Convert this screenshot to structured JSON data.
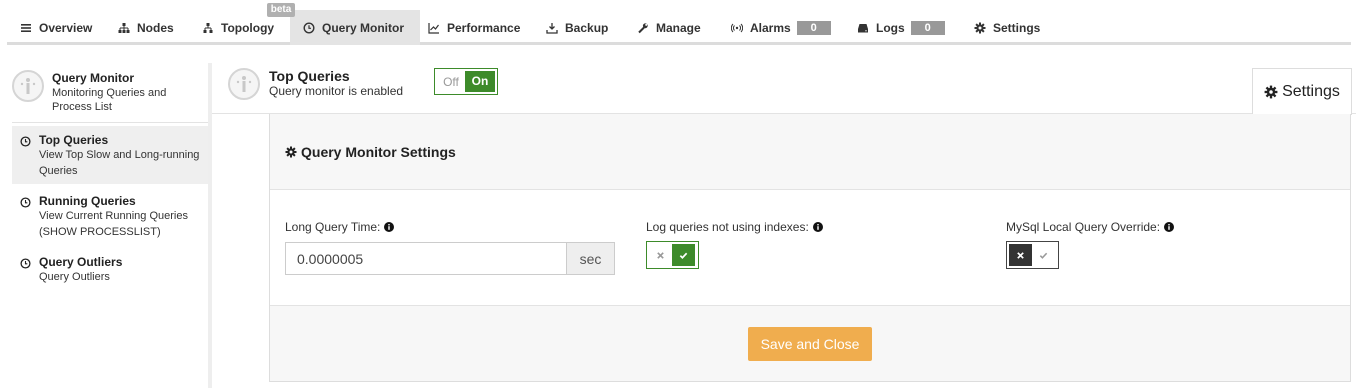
{
  "nav": {
    "beta_badge": "beta",
    "items": [
      {
        "label": "Overview",
        "icon": "list-icon"
      },
      {
        "label": "Nodes",
        "icon": "sitemap-icon"
      },
      {
        "label": "Topology",
        "icon": "topology-icon"
      },
      {
        "label": "Query Monitor",
        "icon": "clock-icon",
        "active": true
      },
      {
        "label": "Performance",
        "icon": "line-chart-icon"
      },
      {
        "label": "Backup",
        "icon": "download-icon"
      },
      {
        "label": "Manage",
        "icon": "wrench-icon"
      },
      {
        "label": "Alarms",
        "icon": "broadcast-icon",
        "badge": "0"
      },
      {
        "label": "Logs",
        "icon": "hdd-icon",
        "badge": "0"
      },
      {
        "label": "Settings",
        "icon": "gear-icon"
      }
    ]
  },
  "sidebar": {
    "title": "Query Monitor",
    "subtitle": "Monitoring Queries and Process List",
    "items": [
      {
        "title": "Top Queries",
        "subtitle": "View Top Slow and Long-running Queries",
        "active": true
      },
      {
        "title": "Running Queries",
        "subtitle": "View Current Running Queries (SHOW PROCESSLIST)"
      },
      {
        "title": "Query Outliers",
        "subtitle": "Query Outliers"
      }
    ]
  },
  "main": {
    "title": "Top Queries",
    "subtitle": "Query monitor is enabled",
    "toggle": {
      "off_label": "Off",
      "on_label": "On",
      "state": "on"
    },
    "settings_tab": "Settings"
  },
  "panel": {
    "title": "Query Monitor Settings",
    "long_query_time": {
      "label": "Long Query Time:",
      "value": "0.0000005",
      "unit": "sec"
    },
    "log_no_index": {
      "label": "Log queries not using indexes:",
      "state": "enabled"
    },
    "local_override": {
      "label": "MySql Local Query Override:",
      "state": "disabled"
    },
    "save_button": "Save and Close"
  },
  "colors": {
    "accent_green": "#3d8b2a",
    "save_orange": "#f0ad4e",
    "active_tab": "#e4e4e4"
  }
}
